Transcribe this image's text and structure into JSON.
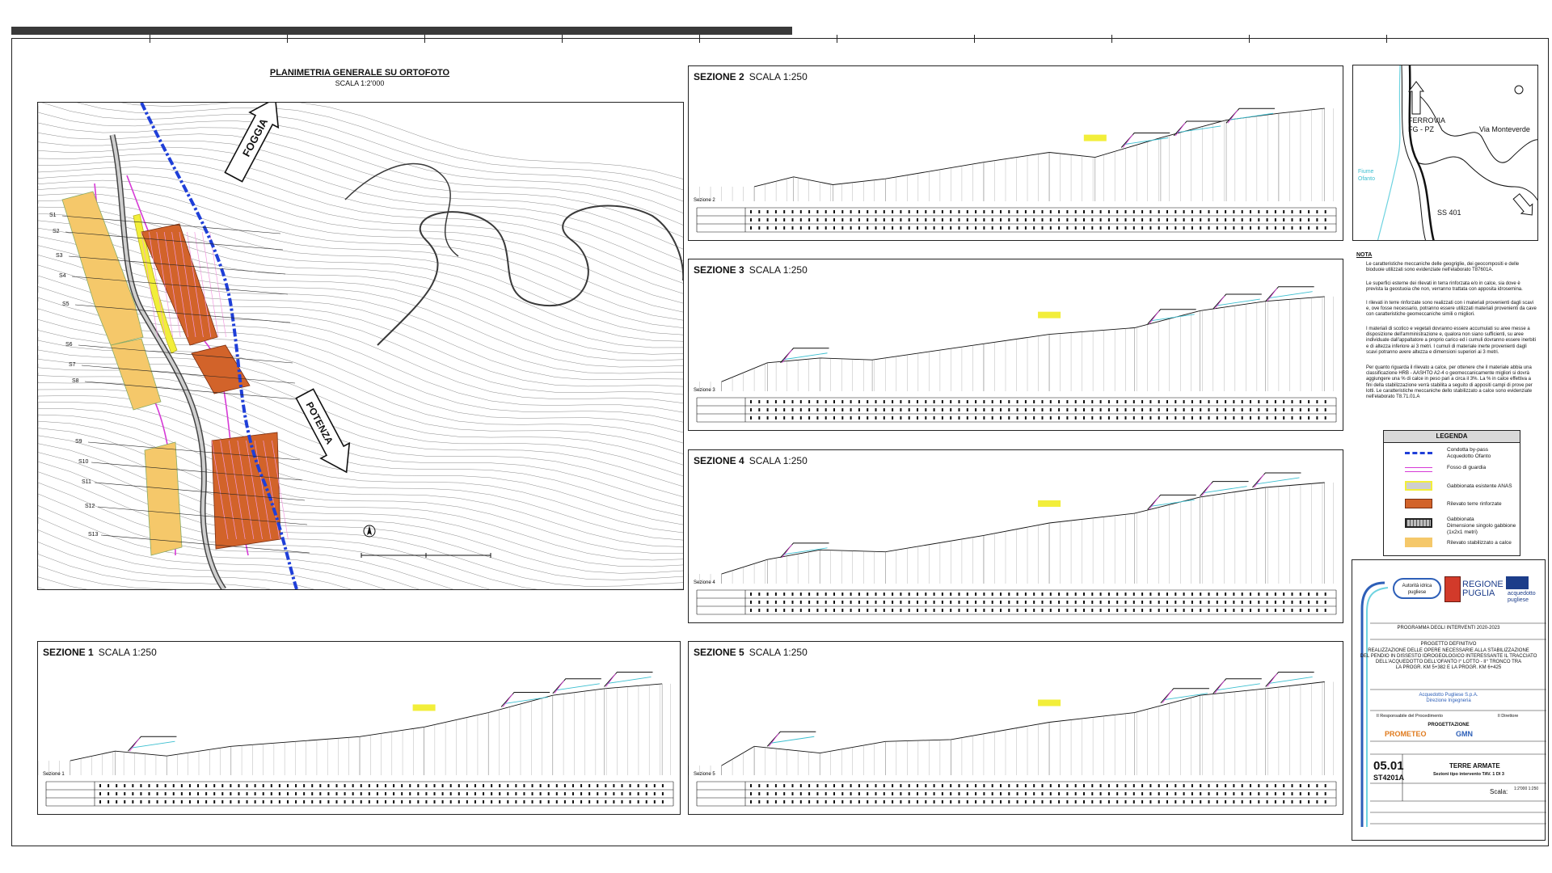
{
  "ortho": {
    "title": "PLANIMETRIA GENERALE SU ORTOFOTO",
    "scale": "SCALA 1:2'000",
    "arrow_north_label": "FOGGIA",
    "arrow_south_label": "POTENZA",
    "section_marks": [
      "S1",
      "S2",
      "S3",
      "S4",
      "S5",
      "S6",
      "S7",
      "S8",
      "S9",
      "S10",
      "S11",
      "S12",
      "S13"
    ]
  },
  "sections": [
    {
      "id": "s2",
      "title": "SEZIONE 2",
      "scale": "SCALA 1:250",
      "label": "Sezione 2"
    },
    {
      "id": "s3",
      "title": "SEZIONE 3",
      "scale": "SCALA 1:250",
      "label": "Sezione 3"
    },
    {
      "id": "s4",
      "title": "SEZIONE 4",
      "scale": "SCALA 1:250",
      "label": "Sezione 4"
    },
    {
      "id": "s5",
      "title": "SEZIONE 5",
      "scale": "SCALA 1:250",
      "label": "Sezione 5"
    },
    {
      "id": "s1",
      "title": "SEZIONE 1",
      "scale": "SCALA 1:250",
      "label": "Sezione 1"
    }
  ],
  "location_map": {
    "rail_label_1": "FERROVIA",
    "rail_label_2": "FG - PZ",
    "road_label": "Via Monteverde",
    "river_label_1": "Fiume",
    "river_label_2": "Ofanto",
    "highway_label": "SS 401"
  },
  "notes": {
    "title": "NOTA",
    "items": [
      "Le caratteristiche meccaniche delle geogriglie, dei geocompositi e delle bioduoie utilizzati sono evidenziate nell'elaborato T87601A.",
      "Le superfici esterne dei rilevati in terra rinforzata e/o in calce, sia dove è prevista la geostuoia che non, verranno trattata con apposita idrosemina.",
      "I rilevati in terre rinforzate sono realizzati con i materiali provenienti dagli scavi e, ove fosse necessario, potranno essere utilizzati materiali provenienti da cave con caratteristiche geomeccaniche simili o migliori.",
      "I materiali di scotico e vegetali dovranno essere accumulati su aree messe a disposizione dell'amministrazione e, qualora non siano sufficienti, su aree individuate dall'appaltatore a proprio carico ed i cumuli dovranno essere inerbiti e di altezza inferiore ai 3 metri. I cumuli di materiale inerte provenienti dagli scavi potranno avere altezza e dimensioni superiori ai 3 metri.",
      "Per quanto riguarda il rilevato a calce, per ottenere che il materiale abbia una classificazione HRB - AASHTO A2-4 o geomeccanicamente migliori si dovrà aggiungere una % di calce in peso pari a circa il 3%. La % in calce effettiva a fini della stabilizzazione verrà stabilita a seguito di appositi campi di prove per lotti. Le caratteristiche meccaniche dello stabilizzato a calce sono evidenziate nell'elaborato T8.71.01.A"
    ]
  },
  "legend": {
    "title": "LEGENDA",
    "items": [
      {
        "label": "Condotta by-pass",
        "label2": "Acquedotto Ofanto",
        "color": "#1f3fd8"
      },
      {
        "label": "Fosso di guardia",
        "label2": "",
        "color": "#d63ad6"
      },
      {
        "label": "Gabbionata esistente ANAS",
        "label2": "",
        "color": "#f2ee3a"
      },
      {
        "label": "Rilevato terre rinforzate",
        "label2": "",
        "color": "#d2632a"
      },
      {
        "label": "Gabbionata",
        "label2": "Dimensione singolo gabbione (1x2x1 metri)",
        "color": "#9a9a9a"
      },
      {
        "label": "Rilevato stabilizzato a calce",
        "label2": "",
        "color": "#f5c86a"
      }
    ]
  },
  "title_block": {
    "logo_1": "Autorità idrica pugliese",
    "logo_2_a": "REGIONE",
    "logo_2_b": "PUGLIA",
    "logo_3_a": "acquedotto",
    "logo_3_b": "pugliese",
    "programma": "PROGRAMMA DEGLI INTERVENTI 2020-2023",
    "progetto": "PROGETTO DEFINITIVO",
    "desc_1": "REALIZZAZIONE DELLE OPERE NECESSARIE ALLA STABILIZZAZIONE",
    "desc_2": "DEL PENDIO IN DISSESTO IDROGEOLOGICO INTERESSANTE IL TRACCIATO",
    "desc_3": "DELL'ACQUEDOTTO DELL'OFANTO I° LOTTO - II° TRONCO TRA",
    "desc_4": "LA PROGR. KM 5+382 E LA PROGR. KM 6+425",
    "ente_1": "Acquedotto Pugliese S.p.A.",
    "ente_2": "Direzione Ingegneria",
    "rup_label": "Il Responsabile del Procedimento",
    "dir_label": "Il Direttore",
    "progettazione": "PROGETTAZIONE",
    "firm": "PROMETEO",
    "firm2": "GMN",
    "elab_number": "05.01",
    "elab_code": "ST4201A",
    "doc_title": "TERRE ARMATE",
    "doc_subtitle": "Sezioni tipo intervento TAV. 1 DI 3",
    "scale_label": "Scala:",
    "scale_values": "1:2'000 1:250"
  }
}
